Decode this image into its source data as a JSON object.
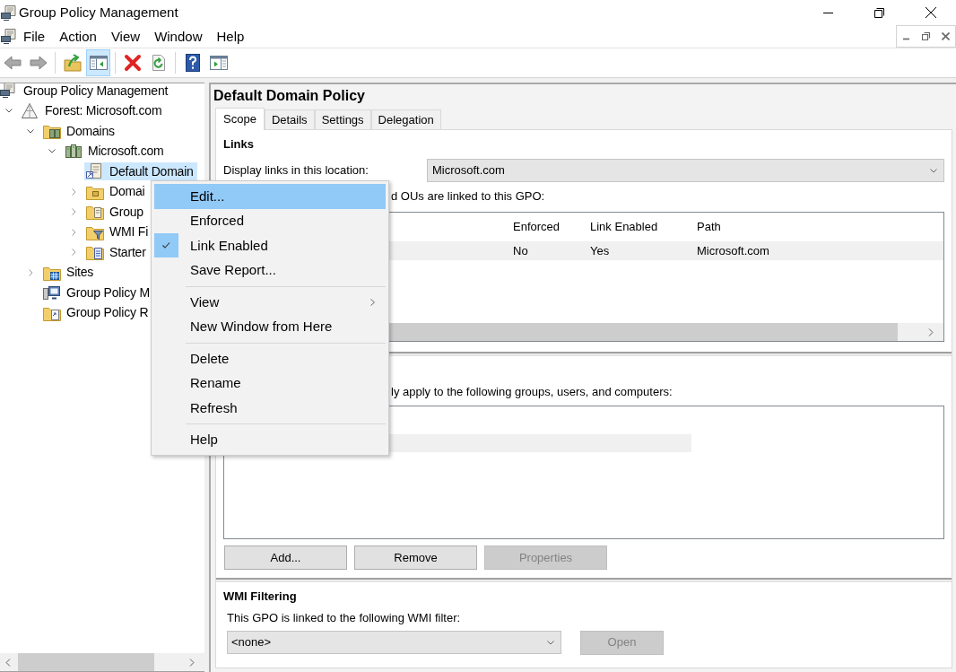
{
  "window": {
    "title": "Group Policy Management"
  },
  "menu_bar": [
    "File",
    "Action",
    "View",
    "Window",
    "Help"
  ],
  "toolbar": [
    {
      "kind": "back",
      "on": false
    },
    {
      "kind": "forward",
      "on": false
    },
    {
      "kind": "separator"
    },
    {
      "kind": "up",
      "on": false
    },
    {
      "kind": "console-tree",
      "on": true
    },
    {
      "kind": "separator"
    },
    {
      "kind": "delete",
      "on": false
    },
    {
      "kind": "refresh",
      "on": false
    },
    {
      "kind": "separator"
    },
    {
      "kind": "help",
      "on": false
    },
    {
      "kind": "action-pane",
      "on": false
    }
  ],
  "tree": [
    {
      "kind": "console",
      "label": "Group Policy Management",
      "selected": false,
      "children": [
        {
          "kind": "forest",
          "label": "Forest: Microsoft.com",
          "expanded": true,
          "selected": false,
          "children": [
            {
              "kind": "domains",
              "label": "Domains",
              "expanded": true,
              "selected": false,
              "children": [
                {
                  "kind": "domain",
                  "label": "Microsoft.com",
                  "expanded": true,
                  "selected": false,
                  "children": [
                    {
                      "kind": "gpo-link",
                      "label": "Default Domain",
                      "selected": true
                    },
                    {
                      "kind": "ou",
                      "label": "Domai",
                      "expanded": false,
                      "selected": false
                    },
                    {
                      "kind": "gpo-folder",
                      "label": "Group",
                      "expanded": false,
                      "selected": false
                    },
                    {
                      "kind": "wmi-folder",
                      "label": "WMI Fi",
                      "expanded": false,
                      "selected": false
                    },
                    {
                      "kind": "starter-folder",
                      "label": "Starter",
                      "expanded": false,
                      "selected": false
                    }
                  ]
                }
              ]
            },
            {
              "kind": "sites",
              "label": "Sites",
              "expanded": false,
              "selected": false
            },
            {
              "kind": "modeling",
              "label": "Group Policy M",
              "selected": false
            },
            {
              "kind": "results",
              "label": "Group Policy R",
              "selected": false
            }
          ]
        }
      ]
    }
  ],
  "details": {
    "title": "Default Domain Policy",
    "tabs": [
      {
        "label": "Scope",
        "selected": true
      },
      {
        "label": "Details",
        "selected": false
      },
      {
        "label": "Settings",
        "selected": false
      },
      {
        "label": "Delegation",
        "selected": false
      }
    ],
    "links": {
      "heading": "Links",
      "location_label": "Display links in this location:",
      "location": "Microsoft.com",
      "caption": "d OUs are linked to this GPO:",
      "columns": [
        "Enforced",
        "Link Enabled",
        "Path"
      ],
      "rows": [
        {
          "cells": [
            "No",
            "Yes",
            "Microsoft.com"
          ],
          "selected": true
        }
      ]
    },
    "security_filtering": {
      "caption": "ly apply to the following groups, users, and computers:",
      "rows": [
        {
          "selected": true
        }
      ],
      "buttons": [
        {
          "label": "Add...",
          "disabled": false
        },
        {
          "label": "Remove",
          "disabled": false
        },
        {
          "label": "Properties",
          "disabled": true
        }
      ]
    },
    "wmi_filtering": {
      "heading": "WMI Filtering",
      "caption": "This GPO is linked to the following WMI filter:",
      "filter": "<none>",
      "button": {
        "label": "Open",
        "disabled": true
      }
    }
  },
  "context_menu": [
    {
      "kind": "item",
      "label": "Edit...",
      "selected": true,
      "checked": false,
      "submenu": false
    },
    {
      "kind": "item",
      "label": "Enforced",
      "selected": false,
      "checked": false,
      "submenu": false
    },
    {
      "kind": "item",
      "label": "Link Enabled",
      "selected": false,
      "checked": true,
      "submenu": false
    },
    {
      "kind": "item",
      "label": "Save Report...",
      "selected": false,
      "checked": false,
      "submenu": false
    },
    {
      "kind": "separator"
    },
    {
      "kind": "item",
      "label": "View",
      "selected": false,
      "checked": false,
      "submenu": true
    },
    {
      "kind": "item",
      "label": "New Window from Here",
      "selected": false,
      "checked": false,
      "submenu": false
    },
    {
      "kind": "separator"
    },
    {
      "kind": "item",
      "label": "Delete",
      "selected": false,
      "checked": false,
      "submenu": false
    },
    {
      "kind": "item",
      "label": "Rename",
      "selected": false,
      "checked": false,
      "submenu": false
    },
    {
      "kind": "item",
      "label": "Refresh",
      "selected": false,
      "checked": false,
      "submenu": false
    },
    {
      "kind": "separator"
    },
    {
      "kind": "item",
      "label": "Help",
      "selected": false,
      "checked": false,
      "submenu": false
    }
  ]
}
